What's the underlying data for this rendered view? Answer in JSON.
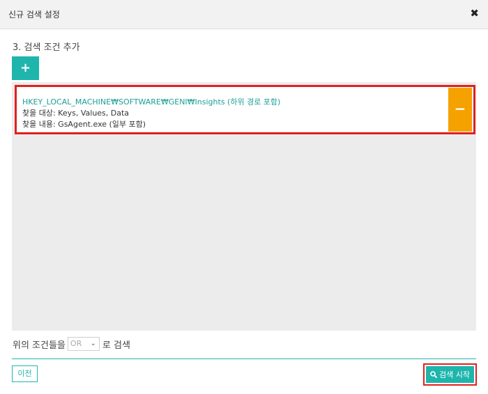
{
  "dialog": {
    "title": "신규 검색 설정",
    "close_glyph": "✖"
  },
  "section": {
    "title": "3. 검색 조건 추가"
  },
  "add_button": {
    "label": "+"
  },
  "conditions": [
    {
      "path": "HKEY_LOCAL_MACHINE₩SOFTWARE₩GENI₩Insights (하위 경로 포함)",
      "target": "찾을 대상: Keys, Values, Data",
      "content": "찾을 내용: GsAgent.exe (일부 포함)",
      "remove_label": "−"
    }
  ],
  "combine": {
    "prefix": "위의 조건들을",
    "selected": "OR",
    "suffix": "로 검색"
  },
  "footer": {
    "prev_label": "이전",
    "start_label": "검색 시작"
  },
  "colors": {
    "accent": "#1fb5ad",
    "remove": "#f5a100",
    "highlight": "#e02020"
  },
  "icons": {
    "close": "close-icon",
    "add": "plus-icon",
    "remove": "minus-icon",
    "dropdown": "chevron-down-icon",
    "search": "search-icon"
  }
}
